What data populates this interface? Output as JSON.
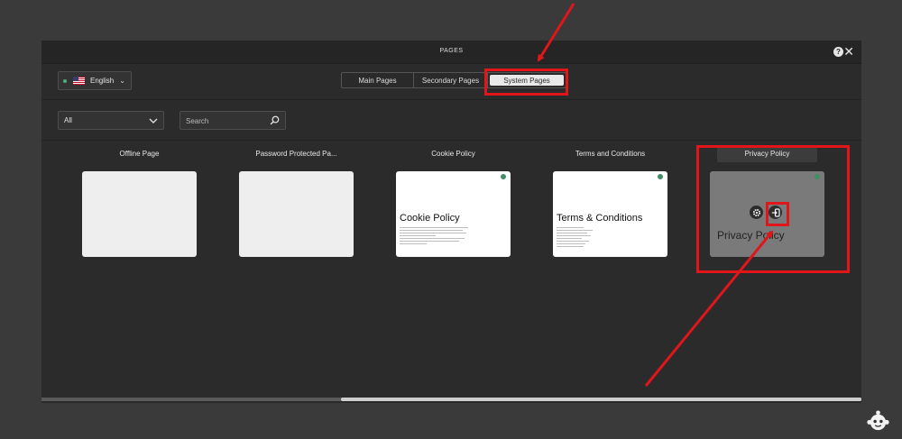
{
  "dialog": {
    "title": "PAGES",
    "help_icon": "?",
    "close_icon": "✕"
  },
  "language": {
    "label": "English",
    "flag_icon": "us-flag-icon",
    "status_color": "#4caf7d"
  },
  "tabs": [
    {
      "label": "Main Pages",
      "active": false
    },
    {
      "label": "Secondary Pages",
      "active": false
    },
    {
      "label": "System Pages",
      "active": true
    }
  ],
  "filter": {
    "selected": "All"
  },
  "search": {
    "placeholder": "Search"
  },
  "pages": [
    {
      "title": "Offline Page"
    },
    {
      "title": "Password Protected Pa..."
    },
    {
      "title": "Cookie Policy",
      "preview_heading": "Cookie Policy"
    },
    {
      "title": "Terms and Conditions",
      "preview_heading": "Terms & Conditions"
    },
    {
      "title": "Privacy Policy",
      "preview_heading": "Privacy Policy"
    }
  ],
  "colors": {
    "highlight": "#e0161b",
    "published_dot": "#3f8f64"
  }
}
